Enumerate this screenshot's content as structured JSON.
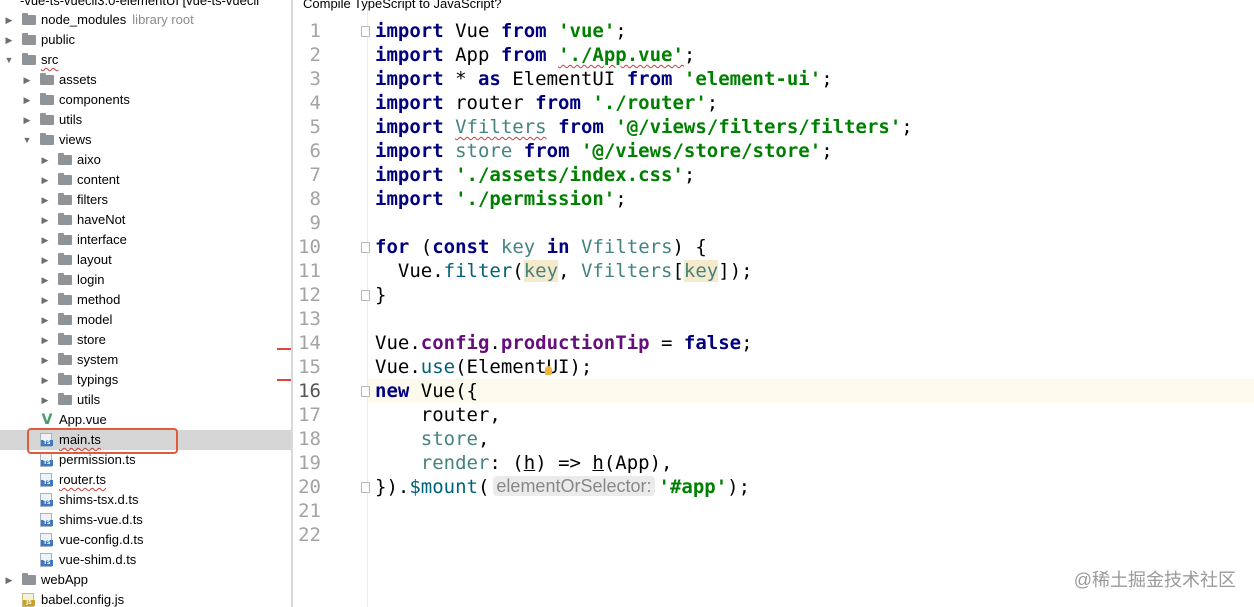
{
  "project_tree": {
    "title": "-vue-ts-vuecli3.0-elementUI [vue-ts-vuecli",
    "items": [
      {
        "label": "node_modules",
        "note": "library root",
        "kind": "folder",
        "depth": 0,
        "expanded": false
      },
      {
        "label": "public",
        "kind": "folder",
        "depth": 0,
        "expanded": false
      },
      {
        "label": "src",
        "kind": "folder",
        "depth": 0,
        "expanded": true,
        "wavy": true
      },
      {
        "label": "assets",
        "kind": "folder",
        "depth": 1,
        "expanded": false
      },
      {
        "label": "components",
        "kind": "folder",
        "depth": 1,
        "expanded": false
      },
      {
        "label": "utils",
        "kind": "folder",
        "depth": 1,
        "expanded": false
      },
      {
        "label": "views",
        "kind": "folder",
        "depth": 1,
        "expanded": true
      },
      {
        "label": "aixo",
        "kind": "folder",
        "depth": 2,
        "expanded": false
      },
      {
        "label": "content",
        "kind": "folder",
        "depth": 2,
        "expanded": false
      },
      {
        "label": "filters",
        "kind": "folder",
        "depth": 2,
        "expanded": false
      },
      {
        "label": "haveNot",
        "kind": "folder",
        "depth": 2,
        "expanded": false
      },
      {
        "label": "interface",
        "kind": "folder",
        "depth": 2,
        "expanded": false
      },
      {
        "label": "layout",
        "kind": "folder",
        "depth": 2,
        "expanded": false
      },
      {
        "label": "login",
        "kind": "folder",
        "depth": 2,
        "expanded": false
      },
      {
        "label": "method",
        "kind": "folder",
        "depth": 2,
        "expanded": false
      },
      {
        "label": "model",
        "kind": "folder",
        "depth": 2,
        "expanded": false
      },
      {
        "label": "store",
        "kind": "folder",
        "depth": 2,
        "expanded": false
      },
      {
        "label": "system",
        "kind": "folder",
        "depth": 2,
        "expanded": false
      },
      {
        "label": "typings",
        "kind": "folder",
        "depth": 2,
        "expanded": false
      },
      {
        "label": "utils",
        "kind": "folder",
        "depth": 2,
        "expanded": false
      },
      {
        "label": "App.vue",
        "kind": "vue",
        "depth": 1
      },
      {
        "label": "main.ts",
        "kind": "ts",
        "depth": 1,
        "selected": true,
        "wavy": true
      },
      {
        "label": "permission.ts",
        "kind": "ts",
        "depth": 1
      },
      {
        "label": "router.ts",
        "kind": "ts",
        "depth": 1,
        "wavy": true
      },
      {
        "label": "shims-tsx.d.ts",
        "kind": "ts",
        "depth": 1
      },
      {
        "label": "shims-vue.d.ts",
        "kind": "ts",
        "depth": 1
      },
      {
        "label": "vue-config.d.ts",
        "kind": "ts",
        "depth": 1
      },
      {
        "label": "vue-shim.d.ts",
        "kind": "ts",
        "depth": 1
      },
      {
        "label": "webApp",
        "kind": "folder",
        "depth": 0,
        "expanded": false
      },
      {
        "label": "babel.config.js",
        "kind": "js",
        "depth": 0
      }
    ]
  },
  "editor": {
    "banner": "Compile TypeScript to JavaScript?",
    "current_line": 16,
    "line_numbers": [
      "1",
      "2",
      "3",
      "4",
      "5",
      "6",
      "7",
      "8",
      "9",
      "10",
      "11",
      "12",
      "13",
      "14",
      "15",
      "16",
      "17",
      "18",
      "19",
      "20",
      "21",
      "22"
    ],
    "fold_markers_at": [
      1,
      10,
      12,
      16,
      20
    ],
    "lines": [
      [
        {
          "t": "import",
          "c": "kw"
        },
        {
          "t": " Vue "
        },
        {
          "t": "from",
          "c": "kw"
        },
        {
          "t": " "
        },
        {
          "t": "'vue'",
          "c": "str"
        },
        {
          "t": ";"
        }
      ],
      [
        {
          "t": "import",
          "c": "kw"
        },
        {
          "t": " App "
        },
        {
          "t": "from",
          "c": "kw"
        },
        {
          "t": " "
        },
        {
          "t": "'./App.vue'",
          "c": "str wavy"
        },
        {
          "t": ";"
        }
      ],
      [
        {
          "t": "import",
          "c": "kw"
        },
        {
          "t": " * "
        },
        {
          "t": "as",
          "c": "kw"
        },
        {
          "t": " ElementUI "
        },
        {
          "t": "from",
          "c": "kw"
        },
        {
          "t": " "
        },
        {
          "t": "'element-ui'",
          "c": "str"
        },
        {
          "t": ";"
        }
      ],
      [
        {
          "t": "import",
          "c": "kw"
        },
        {
          "t": " router "
        },
        {
          "t": "from",
          "c": "kw"
        },
        {
          "t": " "
        },
        {
          "t": "'./router'",
          "c": "str"
        },
        {
          "t": ";"
        }
      ],
      [
        {
          "t": "import",
          "c": "kw"
        },
        {
          "t": " "
        },
        {
          "t": "Vfilters",
          "c": "var wavy"
        },
        {
          "t": " "
        },
        {
          "t": "from",
          "c": "kw"
        },
        {
          "t": " "
        },
        {
          "t": "'@/views/filters/filters'",
          "c": "str"
        },
        {
          "t": ";"
        }
      ],
      [
        {
          "t": "import",
          "c": "kw"
        },
        {
          "t": " "
        },
        {
          "t": "store",
          "c": "var"
        },
        {
          "t": " "
        },
        {
          "t": "from",
          "c": "kw"
        },
        {
          "t": " "
        },
        {
          "t": "'@/views/store/store'",
          "c": "str"
        },
        {
          "t": ";"
        }
      ],
      [
        {
          "t": "import",
          "c": "kw"
        },
        {
          "t": " "
        },
        {
          "t": "'./assets/index.css'",
          "c": "str"
        },
        {
          "t": ";"
        }
      ],
      [
        {
          "t": "import",
          "c": "kw"
        },
        {
          "t": " "
        },
        {
          "t": "'./permission'",
          "c": "str"
        },
        {
          "t": ";"
        }
      ],
      [],
      [
        {
          "t": "for",
          "c": "kw"
        },
        {
          "t": " ("
        },
        {
          "t": "const",
          "c": "kw"
        },
        {
          "t": " "
        },
        {
          "t": "key",
          "c": "var"
        },
        {
          "t": " "
        },
        {
          "t": "in",
          "c": "kw"
        },
        {
          "t": " "
        },
        {
          "t": "Vfilters",
          "c": "var"
        },
        {
          "t": ") {"
        }
      ],
      [
        {
          "t": "  Vue."
        },
        {
          "t": "filter",
          "c": "fn"
        },
        {
          "t": "("
        },
        {
          "t": "key",
          "c": "var param-hl"
        },
        {
          "t": ", "
        },
        {
          "t": "Vfilters",
          "c": "var"
        },
        {
          "t": "["
        },
        {
          "t": "key",
          "c": "var param-hl"
        },
        {
          "t": "]);"
        }
      ],
      [
        {
          "t": "}"
        }
      ],
      [],
      [
        {
          "t": "Vue."
        },
        {
          "t": "config",
          "c": "prop"
        },
        {
          "t": "."
        },
        {
          "t": "productionTip",
          "c": "prop"
        },
        {
          "t": " = "
        },
        {
          "t": "false",
          "c": "kw"
        },
        {
          "t": ";"
        }
      ],
      [
        {
          "t": "Vue."
        },
        {
          "t": "use",
          "c": "fn"
        },
        {
          "t": "(ElementUI);"
        }
      ],
      [
        {
          "t": "new",
          "c": "kw"
        },
        {
          "t": " Vue({"
        }
      ],
      [
        {
          "t": "    router,"
        }
      ],
      [
        {
          "t": "    "
        },
        {
          "t": "store",
          "c": "var"
        },
        {
          "t": ","
        }
      ],
      [
        {
          "t": "    "
        },
        {
          "t": "render",
          "c": "var"
        },
        {
          "t": ": ("
        },
        {
          "t": "h",
          "c": "underline"
        },
        {
          "t": ") => "
        },
        {
          "t": "h",
          "c": "underline"
        },
        {
          "t": "(App),"
        }
      ],
      [
        {
          "t": "})."
        },
        {
          "t": "$mount",
          "c": "fn"
        },
        {
          "t": "("
        },
        {
          "t": "elementOrSelector:",
          "c": "hint"
        },
        {
          "t": "'#app'",
          "c": "str"
        },
        {
          "t": ");"
        }
      ],
      [],
      []
    ]
  },
  "watermark": "@稀土掘金技术社区"
}
